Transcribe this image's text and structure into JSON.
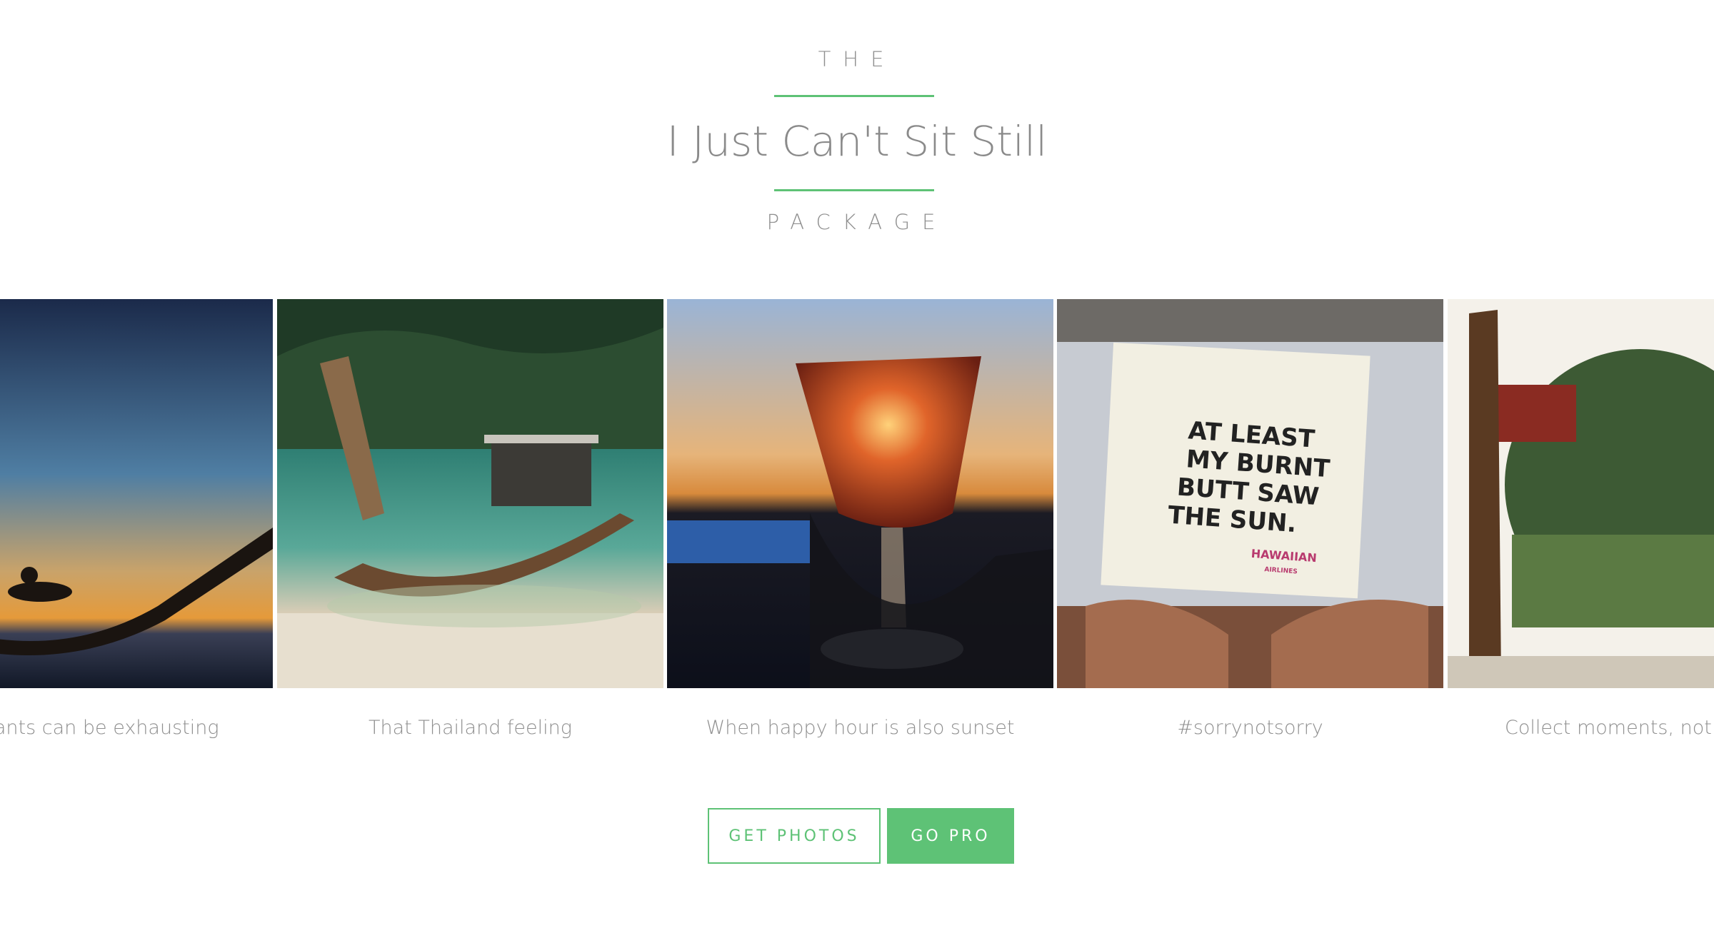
{
  "header": {
    "eyebrow_top": "THE",
    "title": "I Just Can't Sit Still",
    "eyebrow_bottom": "PACKAGE",
    "accent_color": "#5ec276"
  },
  "carousel": {
    "slides": [
      {
        "image": "hammock-sunset-photo",
        "caption": "Elephants can be exhausting"
      },
      {
        "image": "longtail-boat-photo",
        "caption": "That Thailand feeling"
      },
      {
        "image": "cocktail-glass-sunset-photo",
        "caption": "When happy hour is also sunset"
      },
      {
        "image": "airline-napkin-photo",
        "caption": "#sorrynotsorry",
        "napkin_text": [
          "AT LEAST",
          "MY BURNT",
          "BUTT SAW",
          "THE SUN."
        ],
        "napkin_brand": "HAWAIIAN",
        "napkin_sub": "AIRLINES"
      },
      {
        "image": "moon-gate-garden-photo",
        "caption": "Collect moments, not things"
      }
    ]
  },
  "actions": {
    "get_photos_label": "GET PHOTOS",
    "go_pro_label": "GO PRO"
  }
}
